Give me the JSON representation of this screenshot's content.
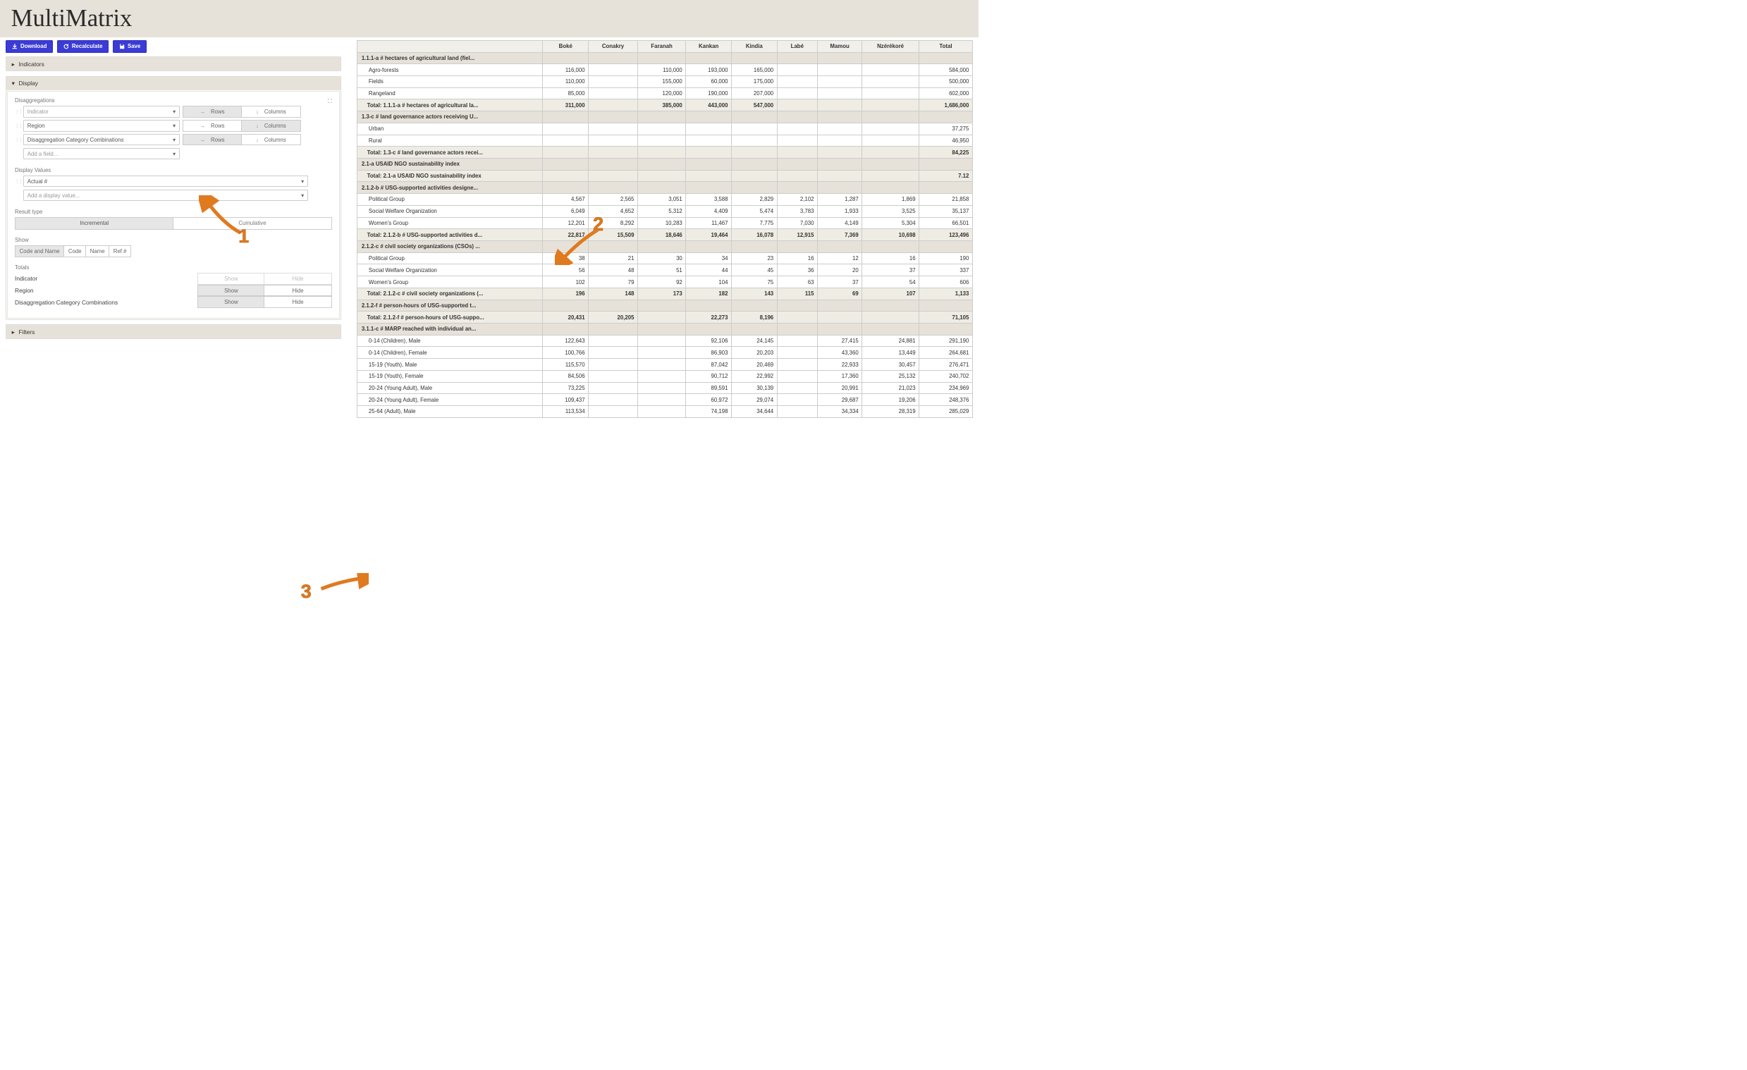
{
  "title": "MultiMatrix",
  "toolbar": {
    "download": "Download",
    "recalculate": "Recalculate",
    "save": "Save"
  },
  "panels": {
    "indicators": "Indicators",
    "display": "Display",
    "filters": "Filters"
  },
  "display": {
    "disaggregations_label": "Disaggregations",
    "fields": {
      "indicator": {
        "label": "Indicator",
        "rows_active": true
      },
      "region": {
        "label": "Region",
        "columns_active": true
      },
      "dcc": {
        "label": "Disaggregation Category Combinations",
        "rows_active": true
      },
      "add_placeholder": "Add a field..."
    },
    "rows_label": "Rows",
    "columns_label": "Columns",
    "display_values_label": "Display Values",
    "actual_label": "Actual #",
    "add_display_placeholder": "Add a display value...",
    "result_type_label": "Result type",
    "result_type": {
      "incremental": "Incremental",
      "cumulative": "Cumulative"
    },
    "show_label": "Show",
    "show_opts": {
      "code_name": "Code and Name",
      "code": "Code",
      "name": "Name",
      "ref": "Ref #"
    },
    "totals_label": "Totals",
    "totals": {
      "indicator": "Indicator",
      "region": "Region",
      "dcc": "Disaggregation Category Combinations",
      "show": "Show",
      "hide": "Hide"
    }
  },
  "table": {
    "columns": [
      "Boké",
      "Conakry",
      "Faranah",
      "Kankan",
      "Kindia",
      "Labé",
      "Mamou",
      "Nzérékoré",
      "Total"
    ],
    "groups": [
      {
        "title": "1.1.1-a # hectares of agricultural land (fiel...",
        "rows": [
          {
            "label": "Agro-forests",
            "values": [
              "116,000",
              "",
              "110,000",
              "193,000",
              "165,000",
              "",
              "",
              "",
              "584,000"
            ]
          },
          {
            "label": "Fields",
            "values": [
              "110,000",
              "",
              "155,000",
              "60,000",
              "175,000",
              "",
              "",
              "",
              "500,000"
            ]
          },
          {
            "label": "Rangeland",
            "values": [
              "85,000",
              "",
              "120,000",
              "190,000",
              "207,000",
              "",
              "",
              "",
              "602,000"
            ]
          }
        ],
        "total_label": "Total: 1.1.1-a # hectares of agricultural la...",
        "total_values": [
          "311,000",
          "",
          "385,000",
          "443,000",
          "547,000",
          "",
          "",
          "",
          "1,686,000"
        ]
      },
      {
        "title": "1.3-c # land governance actors receiving U...",
        "rows": [
          {
            "label": "Urban",
            "values": [
              "",
              "",
              "",
              "",
              "",
              "",
              "",
              "",
              "37,275"
            ]
          },
          {
            "label": "Rural",
            "values": [
              "",
              "",
              "",
              "",
              "",
              "",
              "",
              "",
              "46,950"
            ]
          }
        ],
        "total_label": "Total: 1.3-c # land governance actors recei...",
        "total_values": [
          "",
          "",
          "",
          "",
          "",
          "",
          "",
          "",
          "84,225"
        ]
      },
      {
        "title": "2.1-a USAID NGO sustainability index",
        "rows": [],
        "total_label": "Total: 2.1-a USAID NGO sustainability index",
        "total_values": [
          "",
          "",
          "",
          "",
          "",
          "",
          "",
          "",
          "7.12"
        ]
      },
      {
        "title": "2.1.2-b # USG-supported activities designe...",
        "rows": [
          {
            "label": "Political Group",
            "values": [
              "4,567",
              "2,565",
              "3,051",
              "3,588",
              "2,829",
              "2,102",
              "1,287",
              "1,869",
              "21,858"
            ]
          },
          {
            "label": "Social Welfare Organization",
            "values": [
              "6,049",
              "4,652",
              "5,312",
              "4,409",
              "5,474",
              "3,783",
              "1,933",
              "3,525",
              "35,137"
            ]
          },
          {
            "label": "Women's Group",
            "values": [
              "12,201",
              "8,292",
              "10,283",
              "11,467",
              "7,775",
              "7,030",
              "4,149",
              "5,304",
              "66,501"
            ]
          }
        ],
        "total_label": "Total: 2.1.2-b # USG-supported activities d...",
        "total_values": [
          "22,817",
          "15,509",
          "18,646",
          "19,464",
          "16,078",
          "12,915",
          "7,369",
          "10,698",
          "123,496"
        ]
      },
      {
        "title": "2.1.2-c # civil society organizations (CSOs) ...",
        "rows": [
          {
            "label": "Political Group",
            "values": [
              "38",
              "21",
              "30",
              "34",
              "23",
              "16",
              "12",
              "16",
              "190"
            ]
          },
          {
            "label": "Social Welfare Organization",
            "values": [
              "56",
              "48",
              "51",
              "44",
              "45",
              "36",
              "20",
              "37",
              "337"
            ]
          },
          {
            "label": "Women's Group",
            "values": [
              "102",
              "79",
              "92",
              "104",
              "75",
              "63",
              "37",
              "54",
              "606"
            ]
          }
        ],
        "total_label": "Total: 2.1.2-c # civil society organizations (...",
        "total_values": [
          "196",
          "148",
          "173",
          "182",
          "143",
          "115",
          "69",
          "107",
          "1,133"
        ]
      },
      {
        "title": "2.1.2-f # person-hours of USG-supported t...",
        "rows": [],
        "total_label": "Total: 2.1.2-f # person-hours of USG-suppo...",
        "total_values": [
          "20,431",
          "20,205",
          "",
          "22,273",
          "8,196",
          "",
          "",
          "",
          "71,105"
        ]
      },
      {
        "title": "3.1.1-c # MARP reached with individual an...",
        "rows": [
          {
            "label": "0-14 (Children), Male",
            "values": [
              "122,643",
              "",
              "",
              "92,106",
              "24,145",
              "",
              "27,415",
              "24,881",
              "291,190"
            ]
          },
          {
            "label": "0-14 (Children), Female",
            "values": [
              "100,766",
              "",
              "",
              "86,903",
              "20,203",
              "",
              "43,360",
              "13,449",
              "264,681"
            ]
          },
          {
            "label": "15-19 (Youth), Male",
            "values": [
              "115,570",
              "",
              "",
              "87,042",
              "20,469",
              "",
              "22,933",
              "30,457",
              "276,471"
            ]
          },
          {
            "label": "15-19 (Youth), Female",
            "values": [
              "84,506",
              "",
              "",
              "90,712",
              "22,992",
              "",
              "17,360",
              "25,132",
              "240,702"
            ]
          },
          {
            "label": "20-24 (Young Adult), Male",
            "values": [
              "73,225",
              "",
              "",
              "89,591",
              "30,139",
              "",
              "20,991",
              "21,023",
              "234,969"
            ]
          },
          {
            "label": "20-24 (Young Adult), Female",
            "values": [
              "109,437",
              "",
              "",
              "60,972",
              "29,074",
              "",
              "29,687",
              "19,206",
              "248,376"
            ]
          },
          {
            "label": "25-64 (Adult), Male",
            "values": [
              "113,534",
              "",
              "",
              "74,198",
              "34,644",
              "",
              "34,334",
              "28,319",
              "285,029"
            ]
          }
        ]
      }
    ]
  },
  "annotations": {
    "one": "1",
    "two": "2",
    "three": "3"
  }
}
